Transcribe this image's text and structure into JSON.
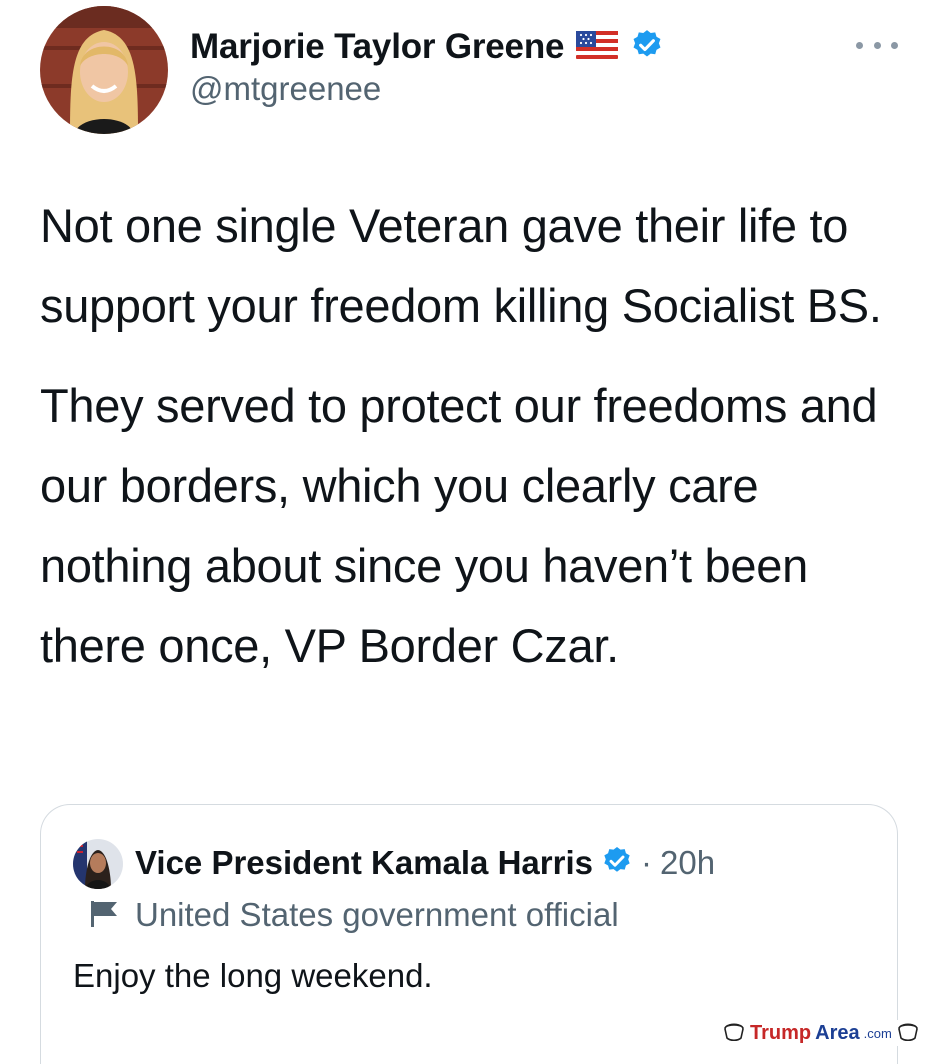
{
  "author": {
    "name": "Marjorie Taylor Greene",
    "handle": "@mtgreenee",
    "flag": "us-flag-icon",
    "verified": "verified-badge-icon"
  },
  "tweet": {
    "paragraphs": [
      "Not one single Veteran gave their life to support your freedom killing Socialist BS.",
      "They served to protect our freedoms and our borders, which you clearly care nothing about since you haven’t been there once, VP Border Czar."
    ]
  },
  "quoted_tweet": {
    "name": "Vice President Kamala Harris",
    "separator": "·",
    "time": "20h",
    "label": "United States government official",
    "text": "Enjoy the long weekend."
  },
  "watermark": {
    "part1": "Trump",
    "part2": "Area",
    "part3": ".com"
  },
  "colors": {
    "text": "#0f1419",
    "secondary": "#536471",
    "verified": "#1d9bf0",
    "border": "#d5dbe0"
  }
}
